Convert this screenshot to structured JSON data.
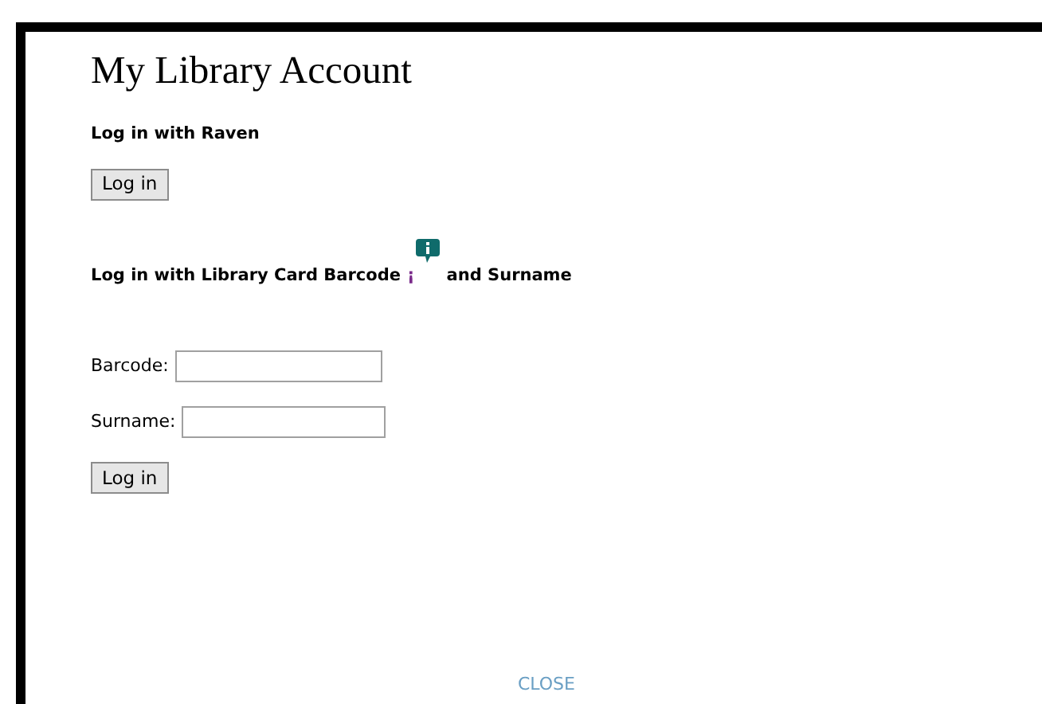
{
  "title": "My Library Account",
  "raven": {
    "heading": "Log in with Raven",
    "button": "Log in"
  },
  "barcode_login": {
    "heading_start": "Log in with Library Card Barcode",
    "info_link": "¡",
    "heading_end": "and Surname",
    "fields": [
      {
        "label": "Barcode:"
      },
      {
        "label": "Surname:"
      }
    ],
    "button": "Log in"
  },
  "close": "CLOSE"
}
